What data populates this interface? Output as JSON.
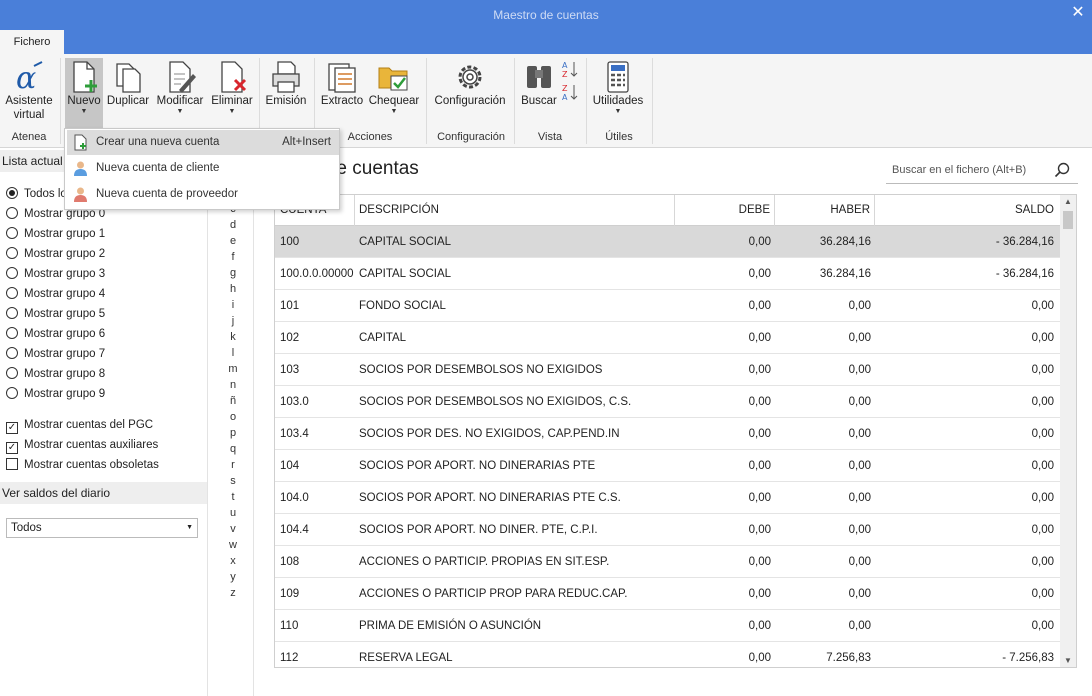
{
  "window": {
    "title": "Maestro de cuentas",
    "close_glyph": "✕"
  },
  "tabs": {
    "file": "Fichero"
  },
  "ribbon": {
    "groups": {
      "atenea": "Atenea",
      "acciones": "Acciones",
      "configuracion": "Configuración",
      "vista": "Vista",
      "utiles": "Útiles"
    },
    "buttons": {
      "asistente_1": "Asistente",
      "asistente_2": "virtual",
      "nuevo": "Nuevo",
      "duplicar": "Duplicar",
      "modificar": "Modificar",
      "eliminar": "Eliminar",
      "emision": "Emisión",
      "extracto": "Extracto",
      "chequear": "Chequear",
      "configuracion": "Configuración",
      "buscar": "Buscar",
      "utilidades": "Utilidades"
    }
  },
  "new_menu": {
    "items": [
      {
        "label": "Crear una nueva cuenta",
        "shortcut": "Alt+Insert"
      },
      {
        "label": "Nueva cuenta de cliente"
      },
      {
        "label": "Nueva cuenta de proveedor"
      }
    ]
  },
  "left": {
    "list_header": "Lista actual",
    "radios": [
      "Todos los",
      "Mostrar grupo 0",
      "Mostrar grupo 1",
      "Mostrar grupo 2",
      "Mostrar grupo 3",
      "Mostrar grupo 4",
      "Mostrar grupo 5",
      "Mostrar grupo 6",
      "Mostrar grupo 7",
      "Mostrar grupo 8",
      "Mostrar grupo 9"
    ],
    "checks": [
      {
        "label": "Mostrar cuentas del PGC",
        "checked": true
      },
      {
        "label": "Mostrar cuentas auxiliares",
        "checked": true
      },
      {
        "label": "Mostrar cuentas obsoletas",
        "checked": false
      }
    ],
    "balances_header": "Ver saldos del diario",
    "balances_value": "Todos"
  },
  "alphabet": [
    "c",
    "d",
    "e",
    "f",
    "g",
    "h",
    "i",
    "j",
    "k",
    "l",
    "m",
    "n",
    "ñ",
    "o",
    "p",
    "q",
    "r",
    "s",
    "t",
    "u",
    "v",
    "w",
    "x",
    "y",
    "z"
  ],
  "main": {
    "title": "o de cuentas",
    "search_placeholder": "Buscar en el fichero (Alt+B)",
    "columns": {
      "cuenta": "CUENTA",
      "descripcion": "DESCRIPCIÓN",
      "debe": "DEBE",
      "haber": "HABER",
      "saldo": "SALDO"
    },
    "rows": [
      {
        "cuenta": "100",
        "desc": "CAPITAL SOCIAL",
        "debe": "0,00",
        "haber": "36.284,16",
        "saldo": "- 36.284,16"
      },
      {
        "cuenta": "100.0.0.00000",
        "desc": "CAPITAL SOCIAL",
        "debe": "0,00",
        "haber": "36.284,16",
        "saldo": "- 36.284,16"
      },
      {
        "cuenta": "101",
        "desc": "FONDO SOCIAL",
        "debe": "0,00",
        "haber": "0,00",
        "saldo": "0,00"
      },
      {
        "cuenta": "102",
        "desc": "CAPITAL",
        "debe": "0,00",
        "haber": "0,00",
        "saldo": "0,00"
      },
      {
        "cuenta": "103",
        "desc": "SOCIOS POR DESEMBOLSOS NO EXIGIDOS",
        "debe": "0,00",
        "haber": "0,00",
        "saldo": "0,00"
      },
      {
        "cuenta": "103.0",
        "desc": "SOCIOS POR DESEMBOLSOS NO EXIGIDOS, C.S.",
        "debe": "0,00",
        "haber": "0,00",
        "saldo": "0,00"
      },
      {
        "cuenta": "103.4",
        "desc": "SOCIOS POR DES. NO EXIGIDOS, CAP.PEND.IN",
        "debe": "0,00",
        "haber": "0,00",
        "saldo": "0,00"
      },
      {
        "cuenta": "104",
        "desc": "SOCIOS POR APORT. NO DINERARIAS PTE",
        "debe": "0,00",
        "haber": "0,00",
        "saldo": "0,00"
      },
      {
        "cuenta": "104.0",
        "desc": "SOCIOS POR APORT. NO DINERARIAS PTE C.S.",
        "debe": "0,00",
        "haber": "0,00",
        "saldo": "0,00"
      },
      {
        "cuenta": "104.4",
        "desc": "SOCIOS POR APORT. NO DINER. PTE, C.P.I.",
        "debe": "0,00",
        "haber": "0,00",
        "saldo": "0,00"
      },
      {
        "cuenta": "108",
        "desc": "ACCIONES O PARTICIP. PROPIAS EN SIT.ESP.",
        "debe": "0,00",
        "haber": "0,00",
        "saldo": "0,00"
      },
      {
        "cuenta": "109",
        "desc": "ACCIONES O PARTICIP PROP PARA REDUC.CAP.",
        "debe": "0,00",
        "haber": "0,00",
        "saldo": "0,00"
      },
      {
        "cuenta": "110",
        "desc": "PRIMA DE EMISIÓN O ASUNCIÓN",
        "debe": "0,00",
        "haber": "0,00",
        "saldo": "0,00"
      },
      {
        "cuenta": "112",
        "desc": "RESERVA LEGAL",
        "debe": "0,00",
        "haber": "7.256,83",
        "saldo": "- 7.256,83"
      }
    ]
  },
  "colors": {
    "titlebar": "#4a7fd9",
    "ribbon": "#f5f5f5",
    "selected_row": "#d9d9d9"
  }
}
